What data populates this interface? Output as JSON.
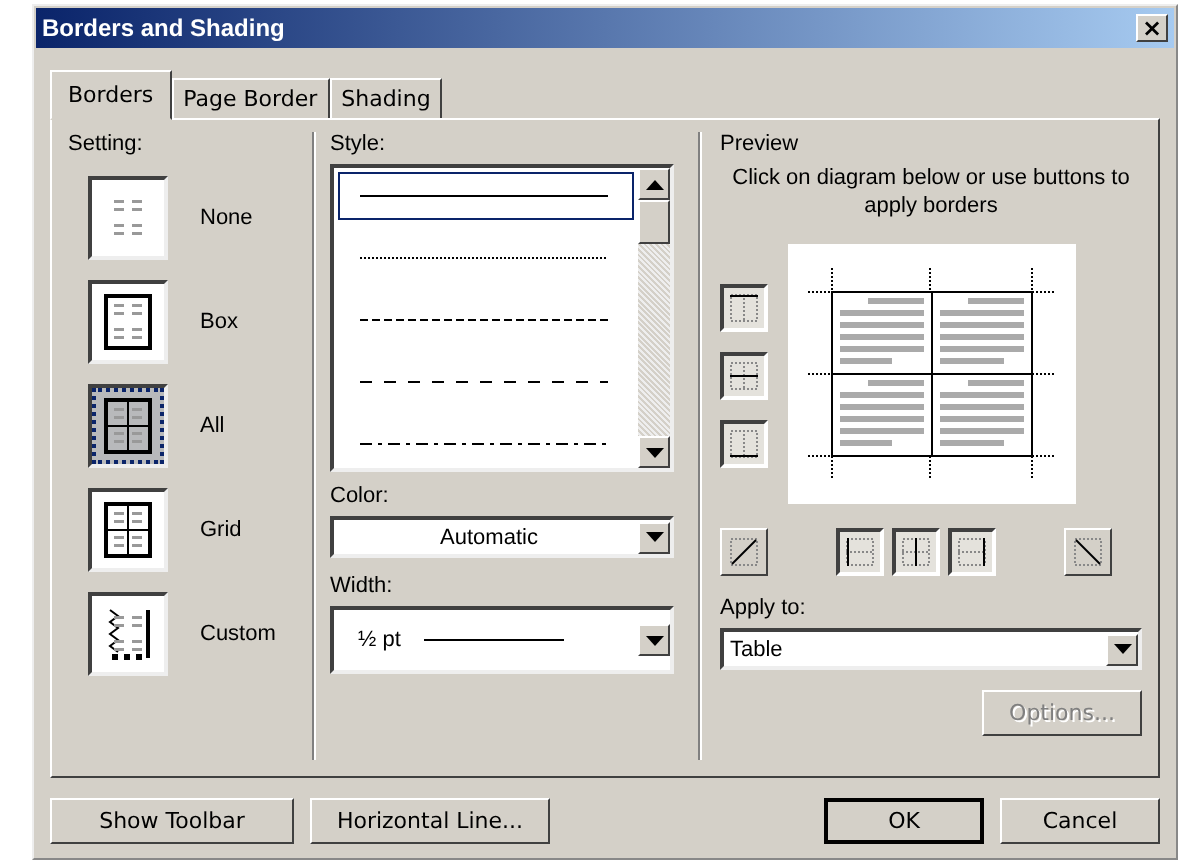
{
  "window": {
    "title": "Borders and Shading",
    "close": "×"
  },
  "tabs": [
    {
      "label": "Borders",
      "selected": true
    },
    {
      "label": "Page Border",
      "selected": false
    },
    {
      "label": "Shading",
      "selected": false
    }
  ],
  "setting": {
    "label": "Setting:",
    "items": [
      {
        "kind": "none",
        "label": "None",
        "selected": false
      },
      {
        "kind": "box",
        "label": "Box",
        "selected": false
      },
      {
        "kind": "all",
        "label": "All",
        "selected": true
      },
      {
        "kind": "grid",
        "label": "Grid",
        "selected": false
      },
      {
        "kind": "custom",
        "label": "Custom",
        "selected": false
      }
    ]
  },
  "style": {
    "label": "Style:",
    "items": [
      {
        "kind": "solid",
        "selected": true
      },
      {
        "kind": "dotted",
        "selected": false
      },
      {
        "kind": "dashed",
        "selected": false
      },
      {
        "kind": "long-dashed",
        "selected": false
      },
      {
        "kind": "dash-dot",
        "selected": false
      }
    ]
  },
  "color": {
    "label": "Color:",
    "value": "Automatic"
  },
  "width": {
    "label": "Width:",
    "value": "½ pt"
  },
  "preview": {
    "label": "Preview",
    "hint": "Click on diagram below or use buttons to apply borders",
    "side_buttons": [
      {
        "kind": "top",
        "on": true
      },
      {
        "kind": "middle",
        "on": true
      },
      {
        "kind": "bottom",
        "on": true
      }
    ],
    "bottom_buttons": [
      {
        "kind": "diag-up",
        "on": false
      },
      {
        "kind": "left",
        "on": true
      },
      {
        "kind": "center",
        "on": true
      },
      {
        "kind": "right",
        "on": true
      },
      {
        "kind": "diag-down",
        "on": false
      }
    ]
  },
  "apply_to": {
    "label": "Apply to:",
    "value": "Table"
  },
  "options_button": {
    "label": "Options...",
    "disabled": true
  },
  "buttons": [
    {
      "label": "Show Toolbar"
    },
    {
      "label": "Horizontal Line..."
    },
    {
      "label": "OK"
    },
    {
      "label": "Cancel"
    }
  ]
}
